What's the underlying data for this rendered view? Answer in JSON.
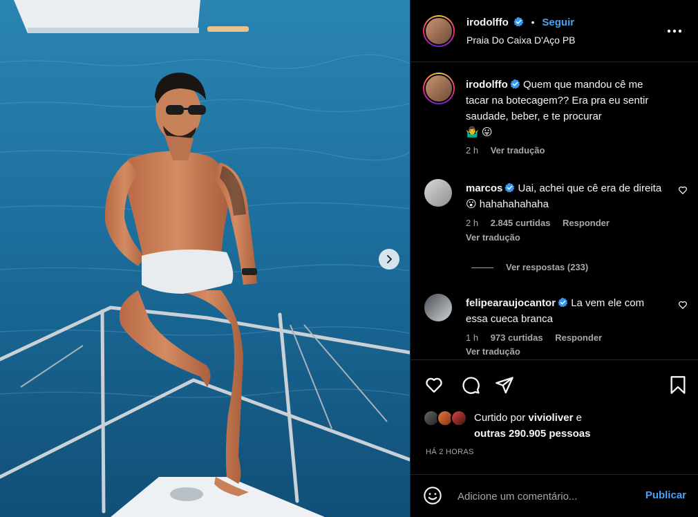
{
  "post": {
    "username": "irodolffo",
    "follow_label": "Seguir",
    "location": "Praia Do Caixa D'Aço PB",
    "more_icon": "more-horizontal-icon"
  },
  "caption": {
    "username": "irodolffo",
    "text": "Quem que mandou cê me tacar na botecagem?? Era pra eu sentir saudade, beber, e te procurar",
    "emoji": "🤷‍♂️ 😛",
    "time": "2 h",
    "translate_label": "Ver tradução"
  },
  "comments": [
    {
      "username": "marcos",
      "text": "Uai, achei que cê era de direita 😮 hahahahahaha",
      "time": "2 h",
      "likes": "2.845 curtidas",
      "reply_label": "Responder",
      "translate_label": "Ver tradução",
      "view_replies": "Ver respostas (233)"
    },
    {
      "username": "felipearaujocantor",
      "text": "La vem ele com essa cueca branca",
      "time": "1 h",
      "likes": "973 curtidas",
      "reply_label": "Responder",
      "translate_label": "Ver tradução"
    }
  ],
  "likes": {
    "prefix": "Curtido por",
    "user": "vivioliver",
    "connector": "e",
    "others": "outras 290.905 pessoas"
  },
  "time_ago": "HÁ 2 HORAS",
  "add_comment": {
    "placeholder": "Adicione um comentário...",
    "publish_label": "Publicar"
  },
  "colors": {
    "accent": "#4aa3f5",
    "background": "#000000",
    "muted": "#a8a8a8",
    "sea": "#1a6a97"
  }
}
